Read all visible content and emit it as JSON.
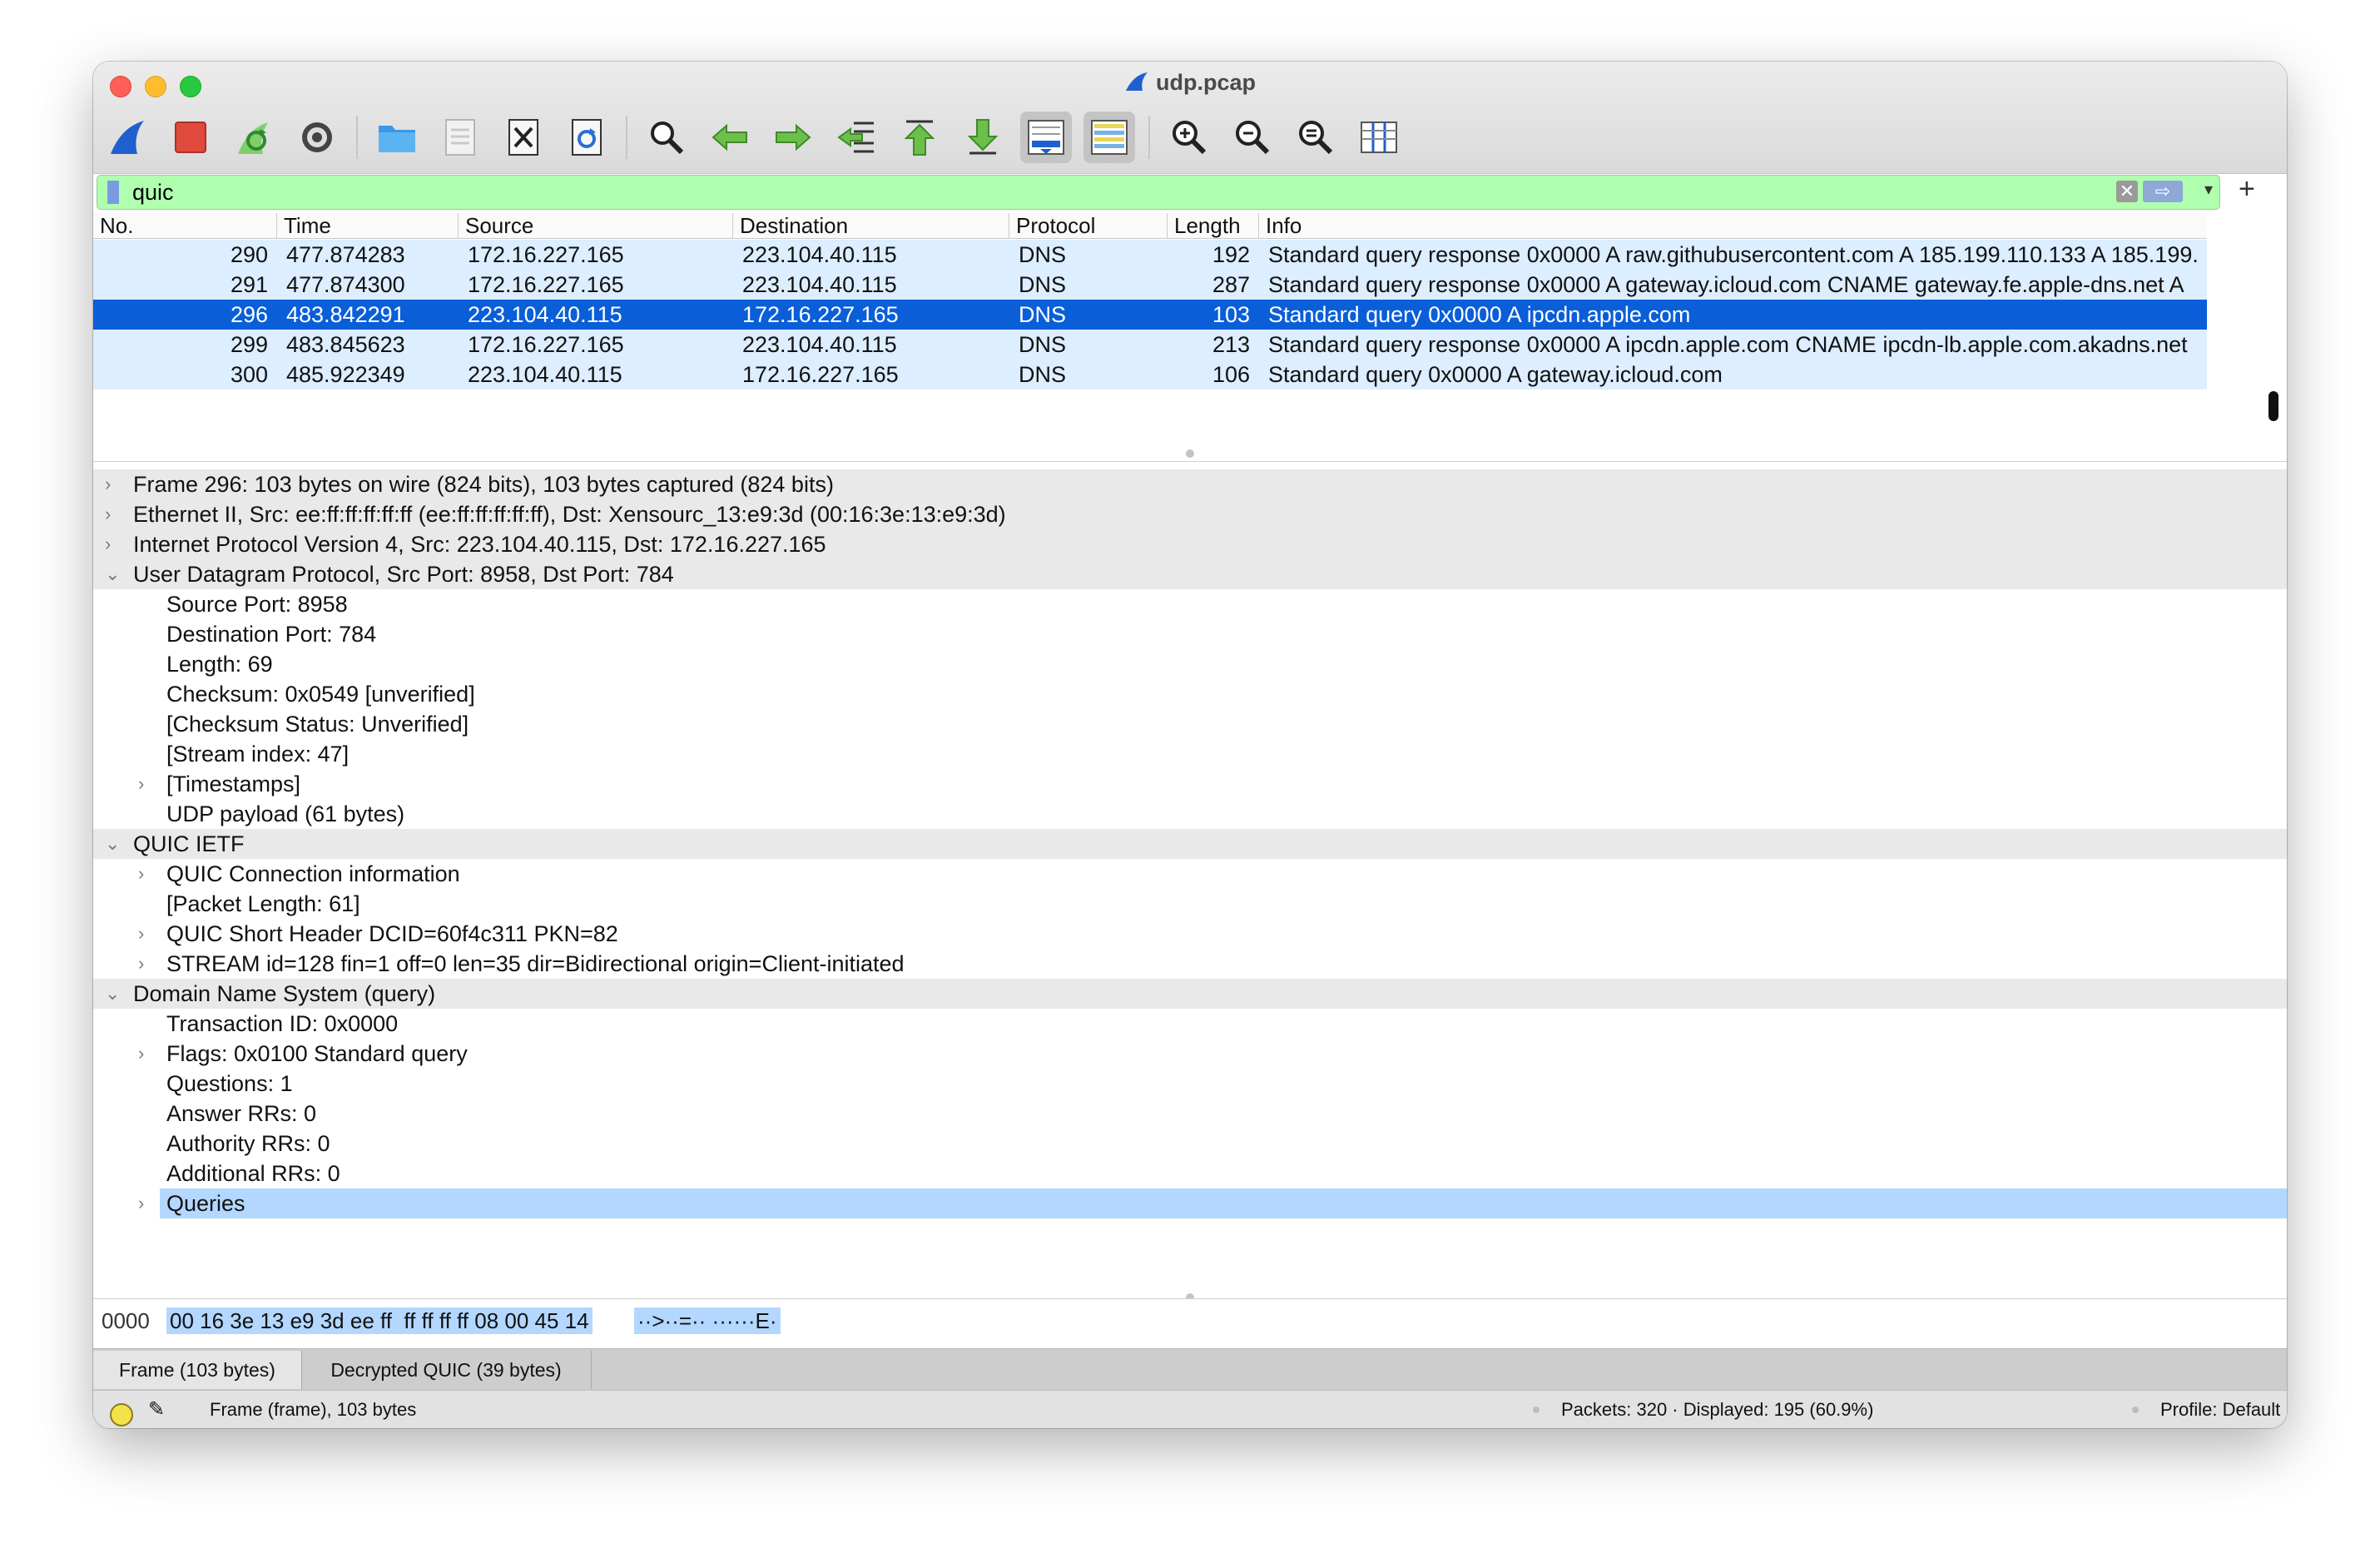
{
  "window": {
    "title": "udp.pcap"
  },
  "filter": {
    "value": "quic"
  },
  "packet_list": {
    "columns": [
      "No.",
      "Time",
      "Source",
      "Destination",
      "Protocol",
      "Length",
      "Info"
    ],
    "rows": [
      {
        "no": "290",
        "time": "477.874283",
        "source": "172.16.227.165",
        "destination": "223.104.40.115",
        "protocol": "DNS",
        "length": "192",
        "info": "Standard query response 0x0000 A raw.githubusercontent.com A 185.199.110.133 A 185.199.",
        "selected": false
      },
      {
        "no": "291",
        "time": "477.874300",
        "source": "172.16.227.165",
        "destination": "223.104.40.115",
        "protocol": "DNS",
        "length": "287",
        "info": "Standard query response 0x0000 A gateway.icloud.com CNAME gateway.fe.apple-dns.net A",
        "selected": false
      },
      {
        "no": "296",
        "time": "483.842291",
        "source": "223.104.40.115",
        "destination": "172.16.227.165",
        "protocol": "DNS",
        "length": "103",
        "info": "Standard query 0x0000 A ipcdn.apple.com",
        "selected": true
      },
      {
        "no": "299",
        "time": "483.845623",
        "source": "172.16.227.165",
        "destination": "223.104.40.115",
        "protocol": "DNS",
        "length": "213",
        "info": "Standard query response 0x0000 A ipcdn.apple.com CNAME ipcdn-lb.apple.com.akadns.net",
        "selected": false
      },
      {
        "no": "300",
        "time": "485.922349",
        "source": "223.104.40.115",
        "destination": "172.16.227.165",
        "protocol": "DNS",
        "length": "106",
        "info": "Standard query 0x0000 A gateway.icloud.com",
        "selected": false
      }
    ]
  },
  "details": [
    {
      "text": "Frame 296: 103 bytes on wire (824 bits), 103 bytes captured (824 bits)",
      "level": 0,
      "arrow": "right"
    },
    {
      "text": "Ethernet II, Src: ee:ff:ff:ff:ff:ff (ee:ff:ff:ff:ff:ff), Dst: Xensourc_13:e9:3d (00:16:3e:13:e9:3d)",
      "level": 0,
      "arrow": "right"
    },
    {
      "text": "Internet Protocol Version 4, Src: 223.104.40.115, Dst: 172.16.227.165",
      "level": 0,
      "arrow": "right"
    },
    {
      "text": "User Datagram Protocol, Src Port: 8958, Dst Port: 784",
      "level": 0,
      "arrow": "down"
    },
    {
      "text": "Source Port: 8958",
      "level": 1,
      "arrow": ""
    },
    {
      "text": "Destination Port: 784",
      "level": 1,
      "arrow": ""
    },
    {
      "text": "Length: 69",
      "level": 1,
      "arrow": ""
    },
    {
      "text": "Checksum: 0x0549 [unverified]",
      "level": 1,
      "arrow": ""
    },
    {
      "text": "[Checksum Status: Unverified]",
      "level": 1,
      "arrow": ""
    },
    {
      "text": "[Stream index: 47]",
      "level": 1,
      "arrow": ""
    },
    {
      "text": "[Timestamps]",
      "level": 1,
      "arrow": "right"
    },
    {
      "text": "UDP payload (61 bytes)",
      "level": 1,
      "arrow": ""
    },
    {
      "text": "QUIC IETF",
      "level": 0,
      "arrow": "down"
    },
    {
      "text": "QUIC Connection information",
      "level": 1,
      "arrow": "right"
    },
    {
      "text": "[Packet Length: 61]",
      "level": 1,
      "arrow": ""
    },
    {
      "text": "QUIC Short Header DCID=60f4c311 PKN=82",
      "level": 1,
      "arrow": "right"
    },
    {
      "text": "STREAM id=128 fin=1 off=0 len=35 dir=Bidirectional origin=Client-initiated",
      "level": 1,
      "arrow": "right"
    },
    {
      "text": "Domain Name System (query)",
      "level": 0,
      "arrow": "down"
    },
    {
      "text": "Transaction ID: 0x0000",
      "level": 1,
      "arrow": ""
    },
    {
      "text": "Flags: 0x0100 Standard query",
      "level": 1,
      "arrow": "right"
    },
    {
      "text": "Questions: 1",
      "level": 1,
      "arrow": ""
    },
    {
      "text": "Answer RRs: 0",
      "level": 1,
      "arrow": ""
    },
    {
      "text": "Authority RRs: 0",
      "level": 1,
      "arrow": ""
    },
    {
      "text": "Additional RRs: 0",
      "level": 1,
      "arrow": ""
    },
    {
      "text": "Queries",
      "level": 1,
      "arrow": "right",
      "highlighted": true
    }
  ],
  "bytes": {
    "offset": "0000",
    "hex": "00 16 3e 13 e9 3d ee ff  ff ff ff ff 08 00 45 14",
    "ascii": "··>··=·· ······E·"
  },
  "tabs": [
    {
      "label": "Frame (103 bytes)",
      "active": true
    },
    {
      "label": "Decrypted QUIC (39 bytes)",
      "active": false
    }
  ],
  "status": {
    "frame": "Frame (frame), 103 bytes",
    "packets": "Packets: 320 · Displayed: 195 (60.9%)",
    "profile": "Profile: Default"
  },
  "toolbar_icons": [
    "shark-fin-start-icon",
    "stop-capture-icon",
    "restart-capture-icon",
    "capture-options-icon",
    "open-folder-icon",
    "save-file-icon",
    "close-file-icon",
    "reload-file-icon",
    "find-packet-icon",
    "go-back-icon",
    "go-forward-icon",
    "go-to-packet-icon",
    "go-first-icon",
    "go-last-icon",
    "autoscroll-icon",
    "colorize-icon",
    "zoom-in-icon",
    "zoom-out-icon",
    "zoom-reset-icon",
    "resize-columns-icon"
  ]
}
